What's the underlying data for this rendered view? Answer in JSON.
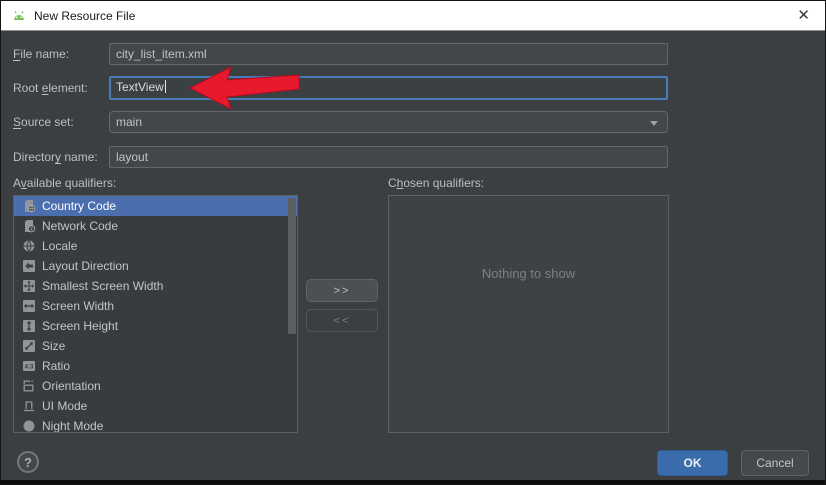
{
  "window": {
    "title": "New Resource File",
    "close_icon": "✕"
  },
  "form": {
    "fields": [
      {
        "id": "file_name",
        "label": "File name:",
        "mnemonic": "F",
        "value": "city_list_item.xml"
      },
      {
        "id": "root_element",
        "label": "Root element:",
        "mnemonic": "e",
        "value": "TextView",
        "focused": true
      },
      {
        "id": "source_set",
        "label": "Source set:",
        "mnemonic": "S",
        "value": "main",
        "control": "dropdown"
      },
      {
        "id": "directory_name",
        "label": "Directory name:",
        "mnemonic": "y",
        "value": "layout"
      }
    ]
  },
  "qualifiers": {
    "available_header": {
      "label": "Available qualifiers:",
      "mnemonic": "v"
    },
    "chosen_header": {
      "label": "Chosen qualifiers:",
      "mnemonic": "h"
    },
    "available": [
      {
        "label": "Country Code",
        "icon": "country-code",
        "selected": true
      },
      {
        "label": "Network Code",
        "icon": "network-code",
        "selected": false
      },
      {
        "label": "Locale",
        "icon": "locale",
        "selected": false
      },
      {
        "label": "Layout Direction",
        "icon": "layout-direction",
        "selected": false
      },
      {
        "label": "Smallest Screen Width",
        "icon": "smallest-screen-width",
        "selected": false
      },
      {
        "label": "Screen Width",
        "icon": "screen-width",
        "selected": false
      },
      {
        "label": "Screen Height",
        "icon": "screen-height",
        "selected": false
      },
      {
        "label": "Size",
        "icon": "size",
        "selected": false
      },
      {
        "label": "Ratio",
        "icon": "ratio",
        "selected": false
      },
      {
        "label": "Orientation",
        "icon": "orientation",
        "selected": false
      },
      {
        "label": "UI Mode",
        "icon": "ui-mode",
        "selected": false
      },
      {
        "label": "Night Mode",
        "icon": "night-mode",
        "selected": false
      }
    ],
    "empty_text": "Nothing to show",
    "add_button": ">>",
    "remove_button": "<<"
  },
  "footer": {
    "help": "?",
    "ok": "OK",
    "cancel": "Cancel"
  },
  "colors": {
    "selection": "#4b6eaf",
    "focus_border": "#4a7ab8",
    "ok_button": "#3a6cab",
    "arrow_annotation": "#e8192c",
    "android_green": "#78c257",
    "titlebar": "#ffffff",
    "dialog_background": "#3c3f41"
  }
}
